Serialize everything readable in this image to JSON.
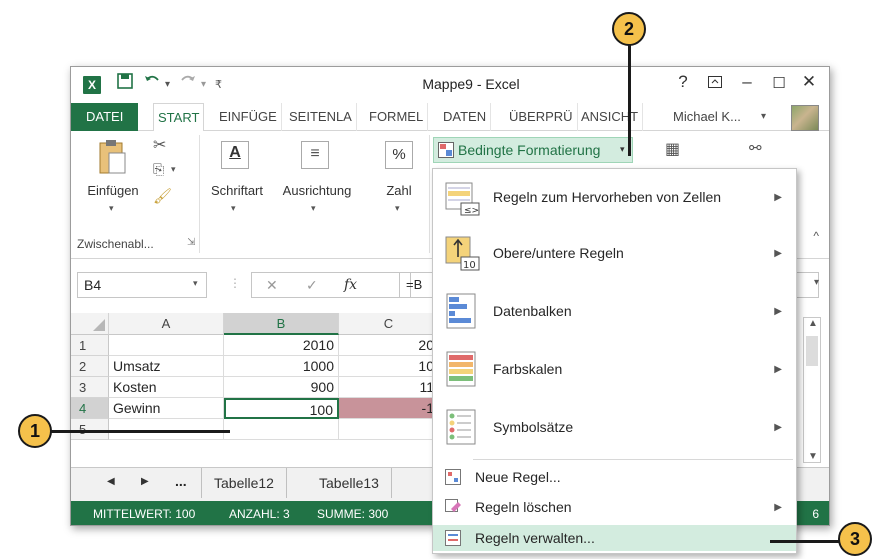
{
  "titlebar": {
    "app_logo": "X",
    "title": "Mappe9 - Excel",
    "help": "?",
    "icons": [
      "excel-logo-icon",
      "save-icon",
      "undo-icon",
      "redo-icon",
      "customize-qat-icon",
      "ribbon-display-icon",
      "minimize-icon",
      "maximize-icon",
      "close-icon"
    ]
  },
  "tabs": {
    "file": "DATEI",
    "start": "START",
    "insert": "EINFÜGE",
    "layout": "SEITENLA",
    "formulas": "FORMEL",
    "data": "DATEN",
    "review": "ÜBERPRÜ",
    "view": "ANSICHT",
    "user": "Michael K..."
  },
  "ribbon": {
    "paste": "Einfügen",
    "clipboard_group": "Zwischenabl...",
    "font": "Schriftart",
    "alignment": "Ausrichtung",
    "number": "Zahl",
    "conditional_formatting": "Bedingte Formatierung"
  },
  "formula_bar": {
    "name_box": "B4",
    "fx": "fx",
    "content": "=B"
  },
  "grid": {
    "columns": [
      "A",
      "B",
      "C"
    ],
    "rows": [
      {
        "num": "1",
        "a": "",
        "b": "2010",
        "c": "20"
      },
      {
        "num": "2",
        "a": "Umsatz",
        "b": "1000",
        "c": "10"
      },
      {
        "num": "3",
        "a": "Kosten",
        "b": "900",
        "c": "11"
      },
      {
        "num": "4",
        "a": "Gewinn",
        "b": "100",
        "c": "-1"
      },
      {
        "num": "5",
        "a": "",
        "b": "",
        "c": ""
      }
    ]
  },
  "sheets": {
    "ellipsis": "...",
    "tab1": "Tabelle12",
    "tab2": "Tabelle13"
  },
  "status": {
    "average": "MITTELWERT: 100",
    "count": "ANZAHL: 3",
    "sum": "SUMME: 300",
    "zoom_fragment": "6"
  },
  "menu": {
    "items": [
      {
        "label": "Regeln zum Hervorheben von Zellen",
        "submenu": true
      },
      {
        "label": "Obere/untere Regeln",
        "submenu": true
      },
      {
        "label": "Datenbalken",
        "submenu": true
      },
      {
        "label": "Farbskalen",
        "submenu": true
      },
      {
        "label": "Symbolsätze",
        "submenu": true
      },
      {
        "label": "Neue Regel...",
        "submenu": false
      },
      {
        "label": "Regeln löschen",
        "submenu": true
      },
      {
        "label": "Regeln verwalten...",
        "submenu": false
      }
    ]
  },
  "callouts": {
    "one": "1",
    "two": "2",
    "three": "3"
  },
  "colors": {
    "excel_green": "#217346",
    "negative_fill": "#c8939a",
    "callout": "#f5c14b",
    "menu_highlight": "#d3ecdf"
  }
}
